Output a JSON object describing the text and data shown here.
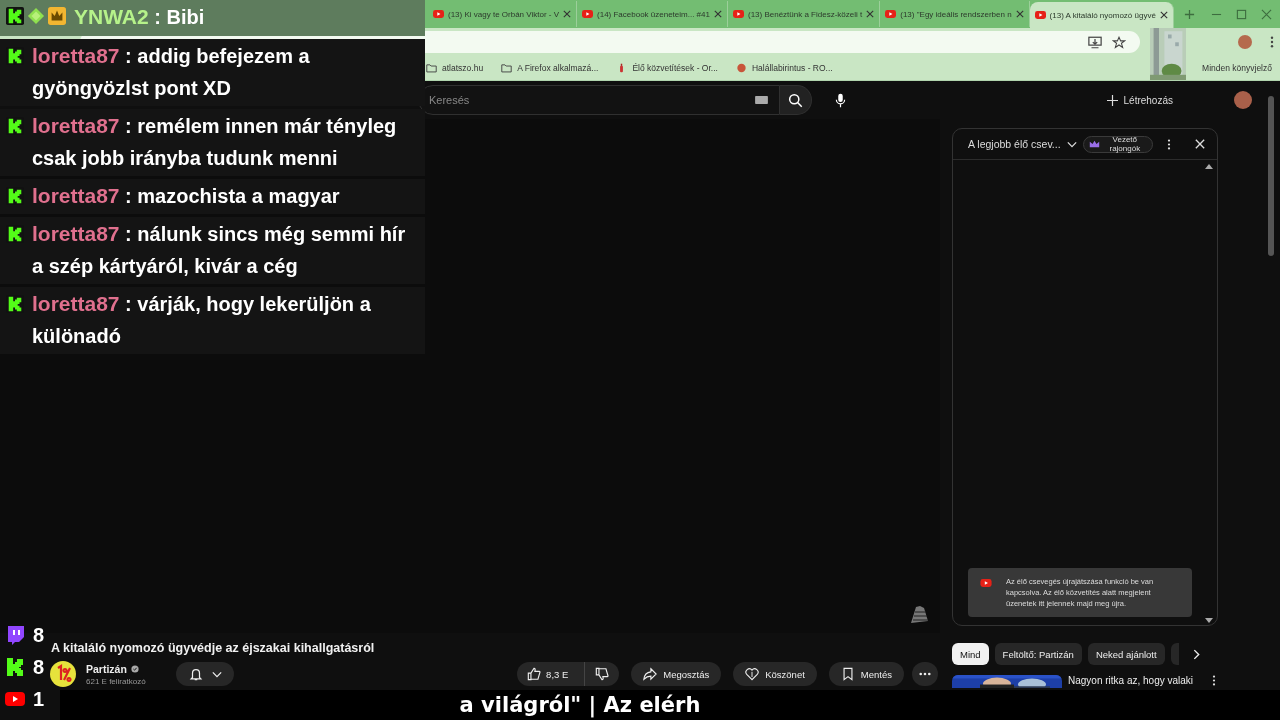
{
  "browser": {
    "tabs": [
      {
        "title": "(13) Ki vagy te Orbán Viktor - V",
        "selected": false
      },
      {
        "title": "(14) Facebook üzeneteim... #41",
        "selected": false
      },
      {
        "title": "(13) Benéztünk a Fidesz-közeli t",
        "selected": false
      },
      {
        "title": "(13) \"Egy ideális rendszerben n",
        "selected": false
      },
      {
        "title": "(13) A kitaláló nyomozó ügyvé",
        "selected": true
      }
    ],
    "bookmarks": [
      {
        "kind": "folder",
        "label": "atlatszo.hu"
      },
      {
        "kind": "folder",
        "label": "A Firefox alkalmazá..."
      },
      {
        "kind": "live",
        "label": "Élő közvetítések - Or..."
      },
      {
        "kind": "site",
        "label": "Halállabirintus - RO..."
      }
    ],
    "all_bookmarks": "Minden könyvjelző"
  },
  "youtube": {
    "search": {
      "placeholder": "Keresés"
    },
    "create_label": "Létrehozás",
    "video": {
      "title": "A kitaláló nyomozó ügyvédje az éjszakai kihallgatásról",
      "channel": "Partizán",
      "subscribers": "621 E feliratkozó",
      "likes": "8,3 E",
      "actions": [
        {
          "kind": "share",
          "label": "Megosztás"
        },
        {
          "kind": "thanks",
          "label": "Köszönet"
        },
        {
          "kind": "save",
          "label": "Mentés"
        }
      ]
    },
    "chat": {
      "title": "A legjobb élő csev...",
      "chip": "Vezető rajongók",
      "notice": "Az élő csevegés újrajátszása funkció be van kapcsolva. Az élő közvetítés alatt megjelent üzenetek itt jelennek majd meg újra."
    },
    "filter_chips": [
      {
        "label": "Mind",
        "selected": true
      },
      {
        "label": "Feltöltő: Partizán",
        "selected": false
      },
      {
        "label": "Neked ajánlott",
        "selected": false
      }
    ],
    "recommended": [
      {
        "title": "Nagyon ritka az, hogy valaki"
      }
    ]
  },
  "overlay": {
    "messages": [
      {
        "badges": [
          {
            "kind": "kick"
          },
          {
            "kind": "diamond"
          },
          {
            "kind": "crown"
          }
        ],
        "name": "YNWA2",
        "color": "#b6f28a",
        "text": ": Bibi"
      },
      {
        "badges": [
          {
            "kind": "kick"
          }
        ],
        "name": "loretta87",
        "color": "#e0708e",
        "text": ": addig befejezem a gyöngyözlst pont XD"
      },
      {
        "badges": [
          {
            "kind": "kick"
          }
        ],
        "name": "loretta87",
        "color": "#e0708e",
        "text": ": remélem innen már tényleg csak jobb irányba tudunk menni"
      },
      {
        "badges": [
          {
            "kind": "kick"
          }
        ],
        "name": "loretta87",
        "color": "#e0708e",
        "text": ": mazochista a magyar"
      },
      {
        "badges": [
          {
            "kind": "kick"
          }
        ],
        "name": "loretta87",
        "color": "#e0708e",
        "text": ": nálunk sincs még semmi hír a szép kártyáról, kivár a cég"
      },
      {
        "badges": [
          {
            "kind": "kick"
          }
        ],
        "name": "loretta87",
        "color": "#e0708e",
        "text": ": várják, hogy lekerüljön a különadó"
      }
    ],
    "viewers": [
      {
        "kind": "twitch",
        "count": "8"
      },
      {
        "kind": "kick",
        "count": "8"
      },
      {
        "kind": "youtube",
        "count": "1"
      }
    ],
    "ticker": "a világról\" | Az elérh"
  }
}
